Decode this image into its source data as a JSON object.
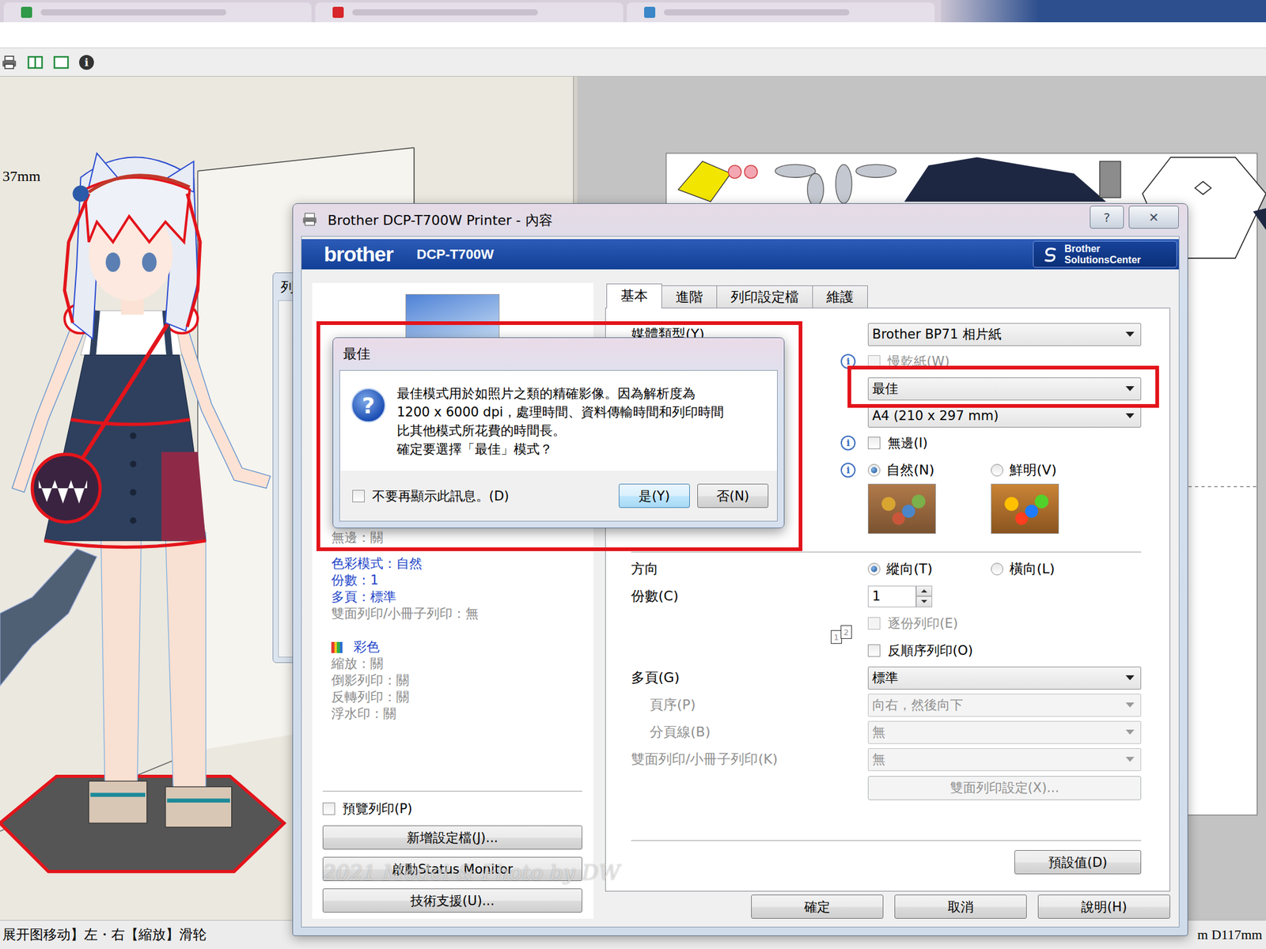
{
  "background_app": {
    "model_view": {
      "dimension": "37mm"
    },
    "status_bar": {
      "hint": "展开图移动】左・右【縮放】滑轮",
      "size": "m D117mm"
    },
    "toolbar": {
      "info_icon": "i"
    },
    "behind_window": {
      "title": "列"
    }
  },
  "dialog": {
    "title": "Brother DCP-T700W Printer - 內容",
    "help_button": "?",
    "close_button": "✕",
    "brand": "brother",
    "model": "DCP-T700W",
    "solutions_center": [
      "Brother",
      "SolutionsCenter"
    ],
    "summary": [
      {
        "text": "無邊：關",
        "highlight": false
      },
      {
        "text": "色彩模式：自然",
        "highlight": true
      },
      {
        "text": "份數：1",
        "highlight": true
      },
      {
        "text": "多頁：標準",
        "highlight": true
      },
      {
        "text": "雙面列印/小冊子列印：無",
        "highlight": false
      }
    ],
    "color_summary": {
      "title": "彩色",
      "items": [
        {
          "text": "縮放：關",
          "highlight": false
        },
        {
          "text": "倒影列印：關",
          "highlight": false
        },
        {
          "text": "反轉列印：關",
          "highlight": false
        },
        {
          "text": "浮水印：關",
          "highlight": false
        }
      ]
    },
    "preview_print": {
      "label": "預覽列印(P)",
      "checked": false
    },
    "side_buttons": [
      "新增設定檔(J)...",
      "啟動Status Monitor",
      "技術支援(U)..."
    ],
    "tabs": [
      {
        "label": "基本",
        "selected": true
      },
      {
        "label": "進階",
        "selected": false
      },
      {
        "label": "列印設定檔",
        "selected": false
      },
      {
        "label": "維護",
        "selected": false
      }
    ],
    "info_glyph": "i",
    "settings": [
      {
        "kind": "select",
        "label": "媒體類型(Y)",
        "value": "Brother BP71 相片紙",
        "disabled": false,
        "info": false
      },
      {
        "kind": "checkbox",
        "label": "慢乾紙(W)",
        "checked": false,
        "disabled": true,
        "info": true
      },
      {
        "kind": "select",
        "label": "",
        "value": "最佳",
        "disabled": false,
        "info": false
      },
      {
        "kind": "select",
        "label": "",
        "value": "A4 (210 x 297 mm)",
        "disabled": false,
        "info": false
      },
      {
        "kind": "checkbox",
        "label": "無邊(I)",
        "checked": false,
        "disabled": false,
        "info": true
      },
      {
        "kind": "radio-images",
        "label": "",
        "disabled": false,
        "info": true,
        "options": [
          {
            "label": "自然(N)",
            "selected": true
          },
          {
            "label": "鮮明(V)",
            "selected": false
          }
        ]
      },
      {
        "kind": "separator"
      },
      {
        "kind": "radio",
        "label": "方向",
        "disabled": false,
        "info": false,
        "options": [
          {
            "label": "縱向(T)",
            "selected": true
          },
          {
            "label": "橫向(L)",
            "selected": false
          }
        ]
      },
      {
        "kind": "spin",
        "label": "份數(C)",
        "value": "1",
        "disabled": false,
        "info": false
      },
      {
        "kind": "checkbox",
        "label": "逐份列印(E)",
        "checked": false,
        "disabled": true,
        "info": false,
        "pages": [
          "1",
          "2"
        ]
      },
      {
        "kind": "checkbox",
        "label": "反順序列印(O)",
        "checked": false,
        "disabled": false,
        "info": false
      },
      {
        "kind": "select",
        "label": "多頁(G)",
        "value": "標準",
        "disabled": false,
        "info": false
      },
      {
        "kind": "subselect",
        "label": "頁序(P)",
        "value": "向右，然後向下",
        "disabled": true,
        "info": false
      },
      {
        "kind": "subselect",
        "label": "分頁線(B)",
        "value": "無",
        "disabled": true,
        "info": false
      },
      {
        "kind": "select",
        "label": "雙面列印/小冊子列印(K)",
        "value": "無",
        "disabled": true,
        "info": false
      },
      {
        "kind": "button",
        "label": "雙面列印設定(X)...",
        "disabled": true,
        "info": false
      }
    ],
    "defaults_button": "預設值(D)",
    "footer_buttons": [
      "確定",
      "取消",
      "說明(H)"
    ]
  },
  "message_box": {
    "title": "最佳",
    "icon": "?",
    "lines": [
      "最佳模式用於如照片之類的精確影像。因為解析度為",
      "1200 x 6000 dpi，處理時間、資料傳輸時間和列印時間",
      "比其他模式所花費的時間長。",
      "確定要選擇「最佳」模式？"
    ],
    "dont_show": {
      "label": "不要再顯示此訊息。(D)",
      "checked": false
    },
    "buttons": [
      {
        "label": "是(Y)",
        "default": true
      },
      {
        "label": "否(N)",
        "default": false
      }
    ]
  },
  "watermark": "2021 Model & Photo by DW"
}
